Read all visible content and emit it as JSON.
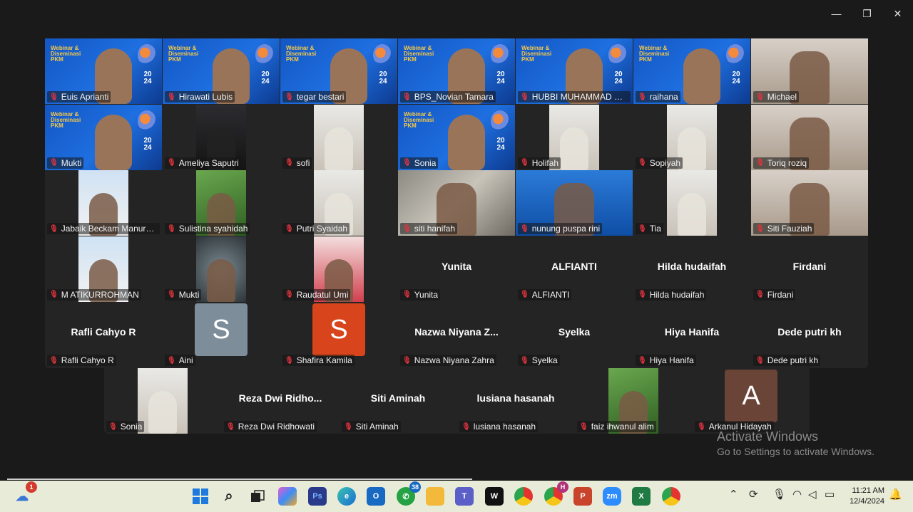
{
  "window_controls": {
    "minimize": "—",
    "maximize": "❐",
    "close": "✕"
  },
  "gallery": [
    {
      "name": "Euis Aprianti",
      "video": "banner"
    },
    {
      "name": "Hirawati Lubis",
      "video": "banner"
    },
    {
      "name": "tegar bestari",
      "video": "banner",
      "active": true
    },
    {
      "name": "BPS_Novian Tamara",
      "video": "banner"
    },
    {
      "name": "HUBBI MUHAMMAD S.Si...",
      "video": "banner"
    },
    {
      "name": "raihana",
      "video": "banner"
    },
    {
      "name": "Michael",
      "video": "room"
    },
    {
      "name": "Mukti",
      "video": "banner"
    },
    {
      "name": "Ameliya Saputri",
      "video": "dark"
    },
    {
      "name": "sofi",
      "video": "wall"
    },
    {
      "name": "Sonia",
      "video": "banner"
    },
    {
      "name": "Holifah",
      "video": "wall"
    },
    {
      "name": "Sopiyah",
      "video": "wall"
    },
    {
      "name": "Toriq roziq",
      "video": "room"
    },
    {
      "name": "Jabaik Beckam Manurung",
      "video": "sky"
    },
    {
      "name": "Sulistina syahidah",
      "video": "green"
    },
    {
      "name": "Putri Syaidah",
      "video": "wall"
    },
    {
      "name": "siti hanifah",
      "video": "stone"
    },
    {
      "name": "nunung puspa rini",
      "video": "blue"
    },
    {
      "name": "Tia",
      "video": "wall"
    },
    {
      "name": "Siti Fauziah",
      "video": "room"
    },
    {
      "name": "M ATIKURROHMAN",
      "video": "sky"
    },
    {
      "name": "Mukti",
      "video": "tree"
    },
    {
      "name": "Raudatul Umi",
      "video": "pink"
    },
    {
      "name": "Yunita",
      "display": "Yunita"
    },
    {
      "name": "ALFIANTI",
      "display": "ALFIANTI"
    },
    {
      "name": "Hilda hudaifah",
      "display": "Hilda hudaifah"
    },
    {
      "name": "Firdani",
      "display": "Firdani"
    },
    {
      "name": "Rafli Cahyo R",
      "display": "Rafli Cahyo R"
    },
    {
      "name": "Aini",
      "avatar": "S",
      "avatar_color": "#7d8e9a"
    },
    {
      "name": "Shafira Kamila",
      "avatar": "S",
      "avatar_color": "#d8451c"
    },
    {
      "name": "Nazwa Niyana Zahra",
      "display": "Nazwa Niyana Z..."
    },
    {
      "name": "Syelka",
      "display": "Syelka"
    },
    {
      "name": "Hiya Hanifa",
      "display": "Hiya Hanifa"
    },
    {
      "name": "Dede putri kh",
      "display": "Dede putri kh"
    }
  ],
  "gallery_row2": [
    {
      "name": "Sonia",
      "video": "wall"
    },
    {
      "name": "Reza Dwi Ridhowati",
      "display": "Reza Dwi Ridho..."
    },
    {
      "name": "Siti Aminah",
      "display": "Siti Aminah"
    },
    {
      "name": "lusiana hasanah",
      "display": "lusiana hasanah"
    },
    {
      "name": "faiz ihwanul alim",
      "video": "green"
    },
    {
      "name": "Arkanul Hidayah",
      "avatar": "A",
      "avatar_color": "#6b4438"
    }
  ],
  "banner": {
    "title": "Webinar & Diseminasi PKM",
    "year": "20 24"
  },
  "watermark": {
    "line1": "Activate Windows",
    "line2": "Go to Settings to activate Windows."
  },
  "taskbar": {
    "weather_badge": "1",
    "whatsapp_badge": "38",
    "chrome_badge": "H",
    "time": "11:21 AM",
    "date": "12/4/2024"
  },
  "colors": {
    "active_speaker": "#23d959",
    "mic_muted": "#e0333d",
    "tile_bg": "#242424"
  }
}
